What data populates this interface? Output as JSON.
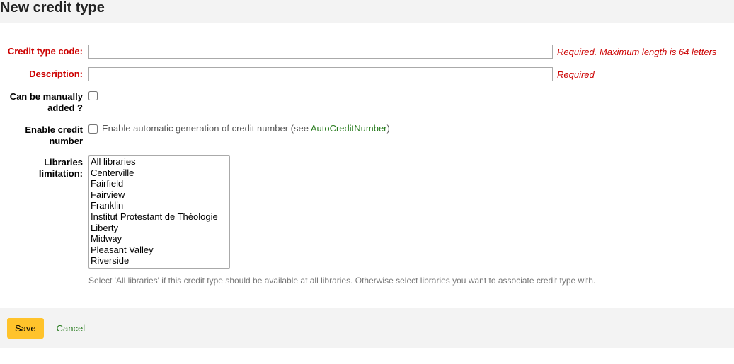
{
  "header": {
    "title": "New credit type"
  },
  "form": {
    "code": {
      "label": "Credit type code:",
      "value": "",
      "hint": "Required. Maximum length is 64 letters"
    },
    "description": {
      "label": "Description:",
      "value": "",
      "hint": "Required"
    },
    "manual": {
      "label": "Can be manually added ?"
    },
    "enable_number": {
      "label": "Enable credit number",
      "after_text_1": "Enable automatic generation of credit number (see ",
      "link_text": "AutoCreditNumber",
      "after_text_2": ")"
    },
    "libraries": {
      "label": "Libraries limitation:",
      "options": [
        "All libraries",
        "Centerville",
        "Fairfield",
        "Fairview",
        "Franklin",
        "Institut Protestant de Théologie",
        "Liberty",
        "Midway",
        "Pleasant Valley",
        "Riverside"
      ],
      "help": "Select 'All libraries' if this credit type should be available at all libraries. Otherwise select libraries you want to associate credit type with."
    }
  },
  "footer": {
    "save": "Save",
    "cancel": "Cancel"
  }
}
